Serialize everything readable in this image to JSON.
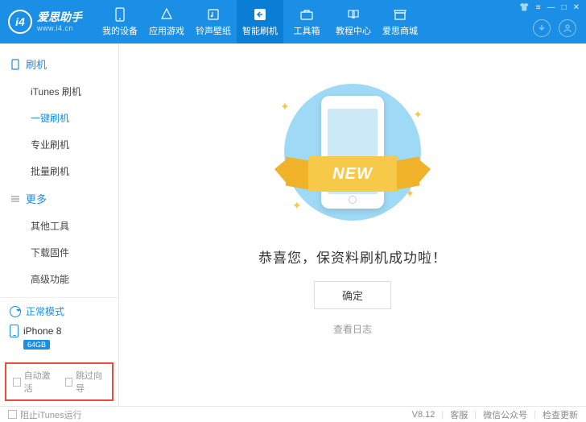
{
  "app": {
    "name": "爱思助手",
    "url": "www.i4.cn",
    "logo_mark": "i4"
  },
  "nav": [
    {
      "label": "我的设备"
    },
    {
      "label": "应用游戏"
    },
    {
      "label": "铃声壁纸"
    },
    {
      "label": "智能刷机"
    },
    {
      "label": "工具箱"
    },
    {
      "label": "教程中心"
    },
    {
      "label": "爱思商城"
    }
  ],
  "nav_active_index": 3,
  "sidebar": {
    "cat1": {
      "title": "刷机",
      "items": [
        "iTunes 刷机",
        "一键刷机",
        "专业刷机",
        "批量刷机"
      ],
      "active_index": 1
    },
    "cat2": {
      "title": "更多",
      "items": [
        "其他工具",
        "下载固件",
        "高级功能"
      ]
    }
  },
  "status": {
    "mode": "正常模式",
    "device_name": "iPhone 8",
    "storage": "64GB"
  },
  "options": {
    "auto_activate": "自动激活",
    "skip_guide": "跳过向导"
  },
  "main": {
    "ribbon": "NEW",
    "message": "恭喜您，保资料刷机成功啦！",
    "ok": "确定",
    "view_log": "查看日志"
  },
  "footer": {
    "block_itunes": "阻止iTunes运行",
    "version": "V8.12",
    "support": "客服",
    "wechat": "微信公众号",
    "check_update": "检查更新"
  }
}
